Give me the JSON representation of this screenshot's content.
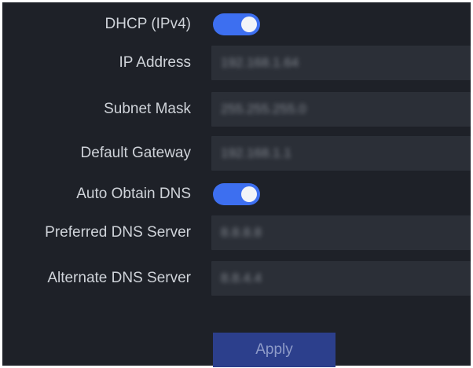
{
  "settings": {
    "dhcp": {
      "label": "DHCP (IPv4)",
      "enabled": true
    },
    "ip_address": {
      "label": "IP Address",
      "value": "192.168.1.64"
    },
    "subnet_mask": {
      "label": "Subnet Mask",
      "value": "255.255.255.0"
    },
    "default_gateway": {
      "label": "Default Gateway",
      "value": "192.168.1.1"
    },
    "auto_obtain_dns": {
      "label": "Auto Obtain DNS",
      "enabled": true
    },
    "preferred_dns": {
      "label": "Preferred DNS Server",
      "value": "8.8.8.8"
    },
    "alternate_dns": {
      "label": "Alternate DNS Server",
      "value": "8.8.4.4"
    }
  },
  "apply_label": "Apply",
  "colors": {
    "background": "#1e2128",
    "field": "#2b2f37",
    "toggle_on": "#3d6ff0",
    "apply_button": "#2c3f8c",
    "label_text": "#cfd3d9"
  }
}
